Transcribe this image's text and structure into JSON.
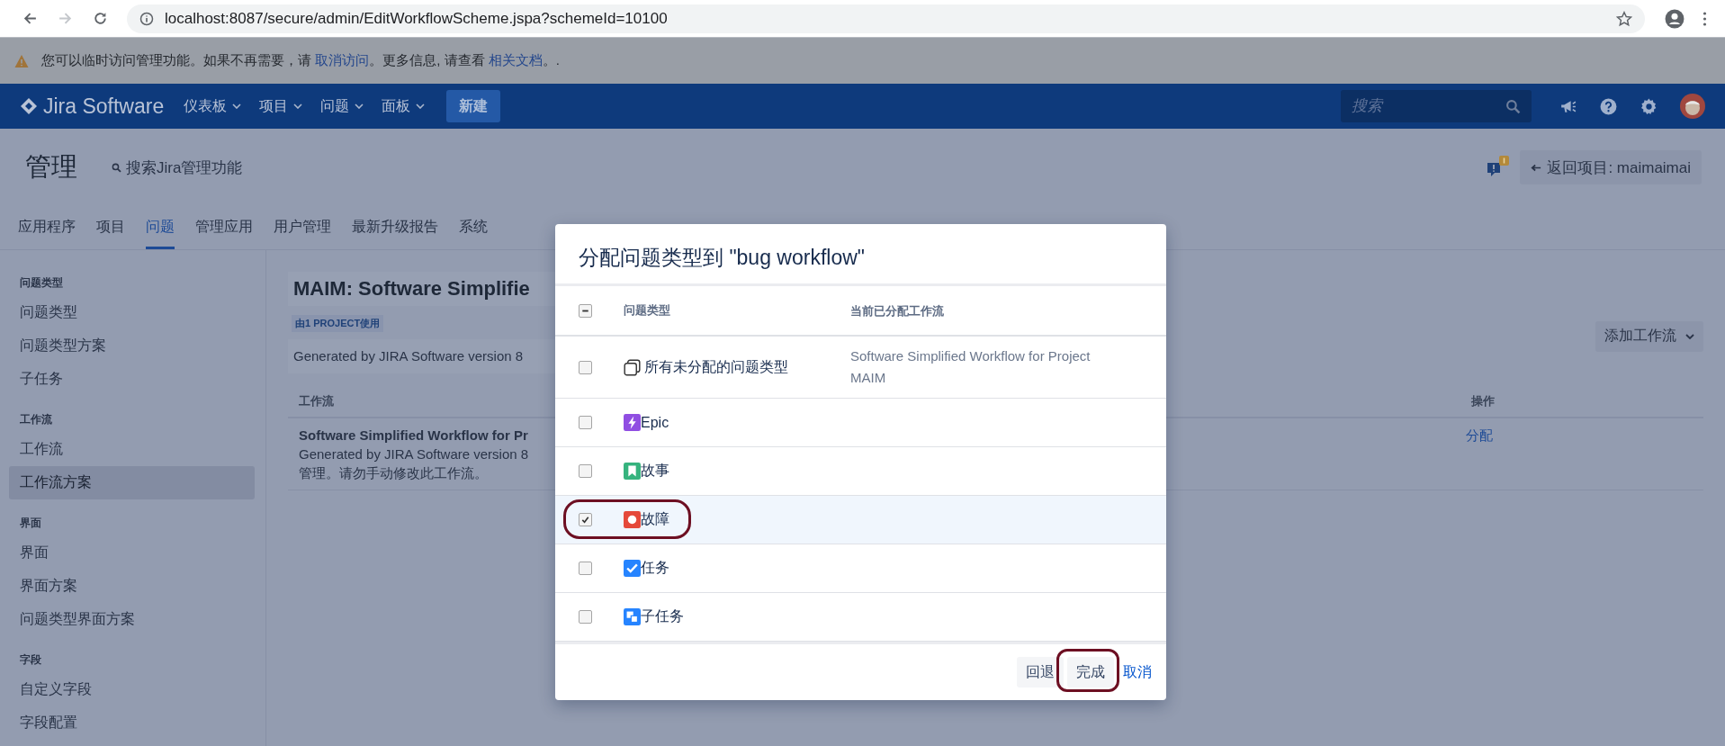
{
  "browser": {
    "url": "localhost:8087/secure/admin/EditWorkflowScheme.jspa?schemeId=10100",
    "forward_disabled": true
  },
  "banner": {
    "parts": [
      {
        "kind": "text",
        "text": "您可以临时访问管理功能。如果不再需要，请 "
      },
      {
        "kind": "link",
        "text": "取消访问"
      },
      {
        "kind": "text",
        "text": "。更多信息, 请查看 "
      },
      {
        "kind": "link",
        "text": "相关文档"
      },
      {
        "kind": "text",
        "text": "。."
      }
    ]
  },
  "nav": {
    "product": "Jira Software",
    "menus": [
      {
        "label": "仪表板"
      },
      {
        "label": "项目"
      },
      {
        "label": "问题"
      },
      {
        "label": "面板"
      }
    ],
    "create": "新建",
    "search": {
      "placeholder": "搜索"
    }
  },
  "admin": {
    "title": "管理",
    "search_link": "搜索Jira管理功能",
    "back_button": "返回项目: maimaimai",
    "tabs": [
      {
        "label": "应用程序",
        "selected": false
      },
      {
        "label": "项目",
        "selected": false
      },
      {
        "label": "问题",
        "selected": true
      },
      {
        "label": "管理应用",
        "selected": false
      },
      {
        "label": "用户管理",
        "selected": false
      },
      {
        "label": "最新升级报告",
        "selected": false
      },
      {
        "label": "系统",
        "selected": false
      }
    ]
  },
  "sidebar": {
    "sections": [
      {
        "heading": "问题类型",
        "items": [
          {
            "label": "问题类型",
            "selected": false
          },
          {
            "label": "问题类型方案",
            "selected": false
          },
          {
            "label": "子任务",
            "selected": false
          }
        ]
      },
      {
        "heading": "工作流",
        "items": [
          {
            "label": "工作流",
            "selected": false
          },
          {
            "label": "工作流方案",
            "selected": true
          }
        ]
      },
      {
        "heading": "界面",
        "items": [
          {
            "label": "界面",
            "selected": false
          },
          {
            "label": "界面方案",
            "selected": false
          },
          {
            "label": "问题类型界面方案",
            "selected": false
          }
        ]
      },
      {
        "heading": "字段",
        "items": [
          {
            "label": "自定义字段",
            "selected": false
          },
          {
            "label": "字段配置",
            "selected": false
          }
        ]
      }
    ]
  },
  "scheme": {
    "title": "MAIM: Software Simplifie",
    "badge": "由1 PROJECT使用",
    "description": "Generated by JIRA Software version 8",
    "add_button": "添加工作流",
    "table": {
      "columns": [
        "工作流",
        "操作"
      ],
      "rows": [
        {
          "name": "Software Simplified Workflow for Pr",
          "description_lines": [
            "Generated by JIRA Software version 8",
            "管理。请勿手动修改此工作流。"
          ],
          "action": "分配"
        }
      ]
    }
  },
  "dialog": {
    "title": "分配问题类型到 \"bug workflow\"",
    "select_all_indeterminate": true,
    "columns": [
      "问题类型",
      "当前已分配工作流"
    ],
    "rows": [
      {
        "kind": "all",
        "label": "所有未分配的问题类型",
        "workflow": "Software Simplified Workflow for Project MAIM",
        "checked": false,
        "annotated": false
      },
      {
        "kind": "epic",
        "label": "Epic",
        "checked": false,
        "annotated": false
      },
      {
        "kind": "story",
        "label": "故事",
        "checked": false,
        "annotated": false
      },
      {
        "kind": "bug",
        "label": "故障",
        "checked": true,
        "annotated": true
      },
      {
        "kind": "task",
        "label": "任务",
        "checked": false,
        "annotated": false
      },
      {
        "kind": "subtask",
        "label": "子任务",
        "checked": false,
        "annotated": false
      }
    ],
    "buttons": [
      {
        "kind": "button",
        "label": "回退",
        "annotated": false
      },
      {
        "kind": "button",
        "label": "完成",
        "annotated": true
      },
      {
        "kind": "link",
        "label": "取消",
        "annotated": false
      }
    ]
  }
}
